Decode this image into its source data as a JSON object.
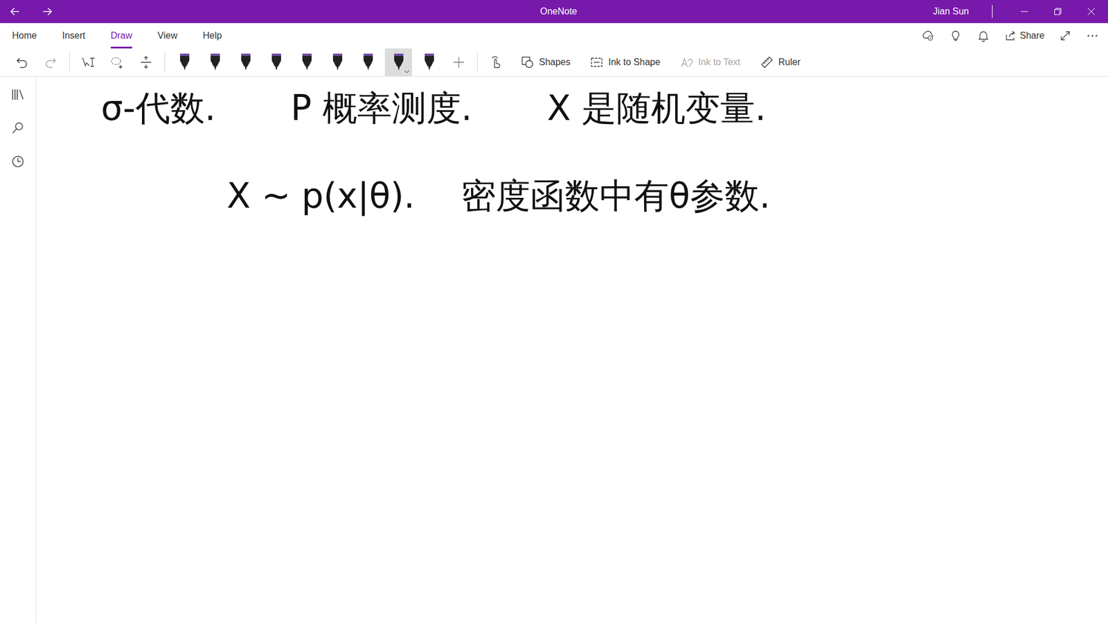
{
  "window": {
    "title": "OneNote",
    "user": "Jian Sun"
  },
  "menu_tabs": [
    {
      "label": "Home",
      "selected": false
    },
    {
      "label": "Insert",
      "selected": false
    },
    {
      "label": "Draw",
      "selected": true
    },
    {
      "label": "View",
      "selected": false
    },
    {
      "label": "Help",
      "selected": false
    }
  ],
  "menu_actions": [
    {
      "label": "Share"
    }
  ],
  "toolbar": {
    "pens": [
      {
        "selected": false
      },
      {
        "selected": false
      },
      {
        "selected": false
      },
      {
        "selected": false
      },
      {
        "selected": false
      },
      {
        "selected": false
      },
      {
        "selected": false
      },
      {
        "selected": true
      },
      {
        "selected": false
      }
    ],
    "actions": [
      {
        "label": "Shapes",
        "disabled": false
      },
      {
        "label": "Ink to Shape",
        "disabled": false
      },
      {
        "label": "Ink to Text",
        "disabled": true
      },
      {
        "label": "Ruler",
        "disabled": false
      }
    ]
  },
  "canvas": {
    "lines": [
      {
        "segments": [
          "σ-代数.",
          "P 概率测度.",
          "X 是随机变量."
        ]
      },
      {
        "segments": [
          "X ~ p(x|θ).",
          "密度函数中有θ参数."
        ]
      }
    ]
  }
}
